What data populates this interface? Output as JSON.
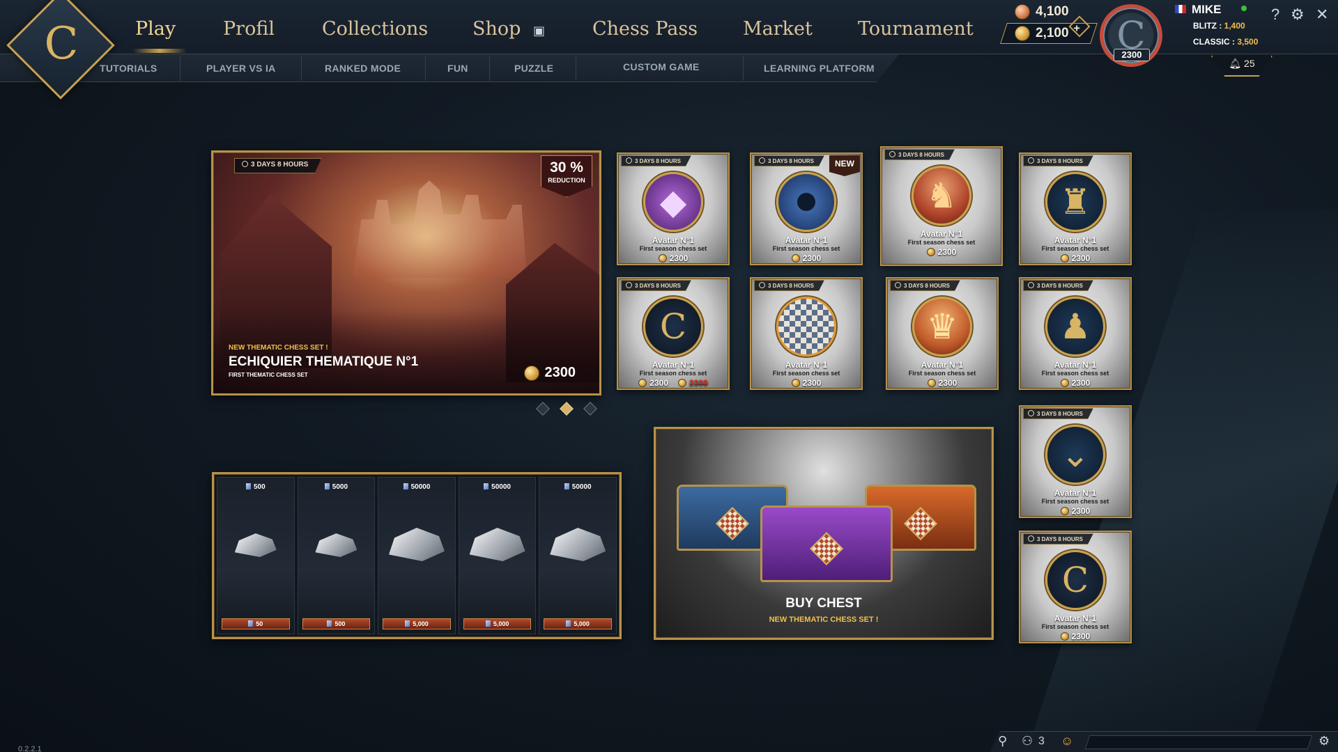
{
  "nav": {
    "main": [
      "Play",
      "Profil",
      "Collections",
      "Shop",
      "Chess Pass",
      "Market",
      "Tournament"
    ],
    "active": "Play",
    "sub": [
      "TUTORIALS",
      "PLAYER VS IA",
      "RANKED MODE",
      "FUN",
      "PUZZLE",
      "CUSTOM GAME",
      "LEARNING PLATFORM"
    ]
  },
  "header": {
    "currency_primary": "4,100",
    "currency_secondary": "2,100",
    "avatar_elo": "2300",
    "username": "MIKE",
    "blitz_label": "BLITZ :",
    "blitz_value": "1,400",
    "classic_label": "CLASSIC :",
    "classic_value": "3,500",
    "notifications": "25",
    "icons": [
      "help-icon",
      "settings-icon",
      "close-icon",
      "bell-icon",
      "plus-icon"
    ]
  },
  "hero": {
    "timer": "3 DAYS 8 HOURS",
    "reduction_pct": "30 %",
    "reduction_label": "REDUCTION",
    "kicker": "NEW THEMATIC CHESS SET !",
    "title": "ECHIQUIER THEMATIQUE N°1",
    "subtitle": "FIRST THEMATIC CHESS SET",
    "price": "2300",
    "carousel_active": 1
  },
  "items": [
    {
      "timer": "3 DAYS 8 HOURS",
      "name": "Avatar N°1",
      "sub": "First season chess set",
      "price": "2300",
      "art": "diamond-icon"
    },
    {
      "timer": "3 DAYS 8 HOURS",
      "name": "Avatar N°1",
      "sub": "First season chess set",
      "price": "2300",
      "art": "ring-icon",
      "badge": "NEW"
    },
    {
      "timer": "3 DAYS 8 HOURS",
      "name": "Avatar N°1",
      "sub": "First season chess set",
      "price": "2300",
      "art": "knight-icon"
    },
    {
      "timer": "3 DAYS 8 HOURS",
      "name": "Avatar N°1",
      "sub": "First season chess set",
      "price": "2300",
      "art": "rook-icon"
    },
    {
      "timer": "3 DAYS 8 HOURS",
      "name": "Avatar N°1",
      "sub": "First season chess set",
      "price": "2300",
      "old_price": "2300",
      "art": "logo-icon"
    },
    {
      "timer": "3 DAYS 8 HOURS",
      "name": "Avatar N°1",
      "sub": "First season chess set",
      "price": "2300",
      "art": "chessboard-icon"
    },
    {
      "timer": "3 DAYS 8 HOURS",
      "name": "Avatar N°1",
      "sub": "First season chess set",
      "price": "2300",
      "art": "queen-icon"
    },
    {
      "timer": "3 DAYS 8 HOURS",
      "name": "Avatar N°1",
      "sub": "First season chess set",
      "price": "2300",
      "art": "pawn-icon"
    },
    {
      "timer": "3 DAYS 8 HOURS",
      "name": "Avatar N°1",
      "sub": "First season chess set",
      "price": "2300",
      "art": "chevron-icon"
    },
    {
      "timer": "3 DAYS 8 HOURS",
      "name": "Avatar N°1",
      "sub": "First season chess set",
      "price": "2300",
      "art": "logo-icon"
    }
  ],
  "bundles": [
    {
      "qty": "500",
      "price": "50"
    },
    {
      "qty": "5000",
      "price": "500"
    },
    {
      "qty": "50000",
      "price": "5,000"
    },
    {
      "qty": "50000",
      "price": "5,000"
    },
    {
      "qty": "50000",
      "price": "5,000"
    }
  ],
  "chest": {
    "title": "BUY CHEST",
    "subtitle": "NEW THEMATIC CHESS SET !"
  },
  "footer": {
    "friends_count": "3",
    "version": "0.2.2.1"
  }
}
